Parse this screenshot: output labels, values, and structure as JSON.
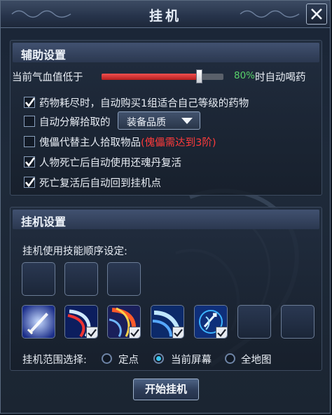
{
  "window": {
    "title": "挂机",
    "close_icon": "close-icon"
  },
  "assist": {
    "header": "辅助设置",
    "hp_label_prefix": "当前气血值低于",
    "hp_value": "80%",
    "hp_fraction": 0.8,
    "hp_label_suffix": "时自动喝药",
    "options": [
      {
        "label": "药物耗尽时，自动购买1组适合自己等级的药物",
        "checked": true
      },
      {
        "label": "自动分解拾取的",
        "checked": false
      },
      {
        "label": "傀儡代替主人拾取物品",
        "note": "(傀儡需达到3阶)",
        "checked": false
      },
      {
        "label": "人物死亡后自动使用还魂丹复活",
        "checked": true
      },
      {
        "label": "死亡复活后自动回到挂机点",
        "checked": true
      }
    ],
    "quality_select": "装备品质"
  },
  "hangup": {
    "header": "挂机设置",
    "skill_order_label": "挂机使用技能顺序设定:",
    "order_slots": 3,
    "skills": [
      {
        "icon": "sword-skill-icon",
        "checked": false
      },
      {
        "icon": "slash-skill-icon",
        "checked": true
      },
      {
        "icon": "flame-slash-skill-icon",
        "checked": true
      },
      {
        "icon": "wave-skill-icon",
        "checked": true
      },
      {
        "icon": "archer-skill-icon",
        "checked": true
      },
      {
        "icon": "empty-slot",
        "checked": false
      },
      {
        "icon": "empty-slot",
        "checked": false
      }
    ],
    "range_label": "挂机范围选择:",
    "range_options": [
      "定点",
      "当前屏幕",
      "全地图"
    ],
    "range_selected": "当前屏幕"
  },
  "start_button": "开始挂机"
}
